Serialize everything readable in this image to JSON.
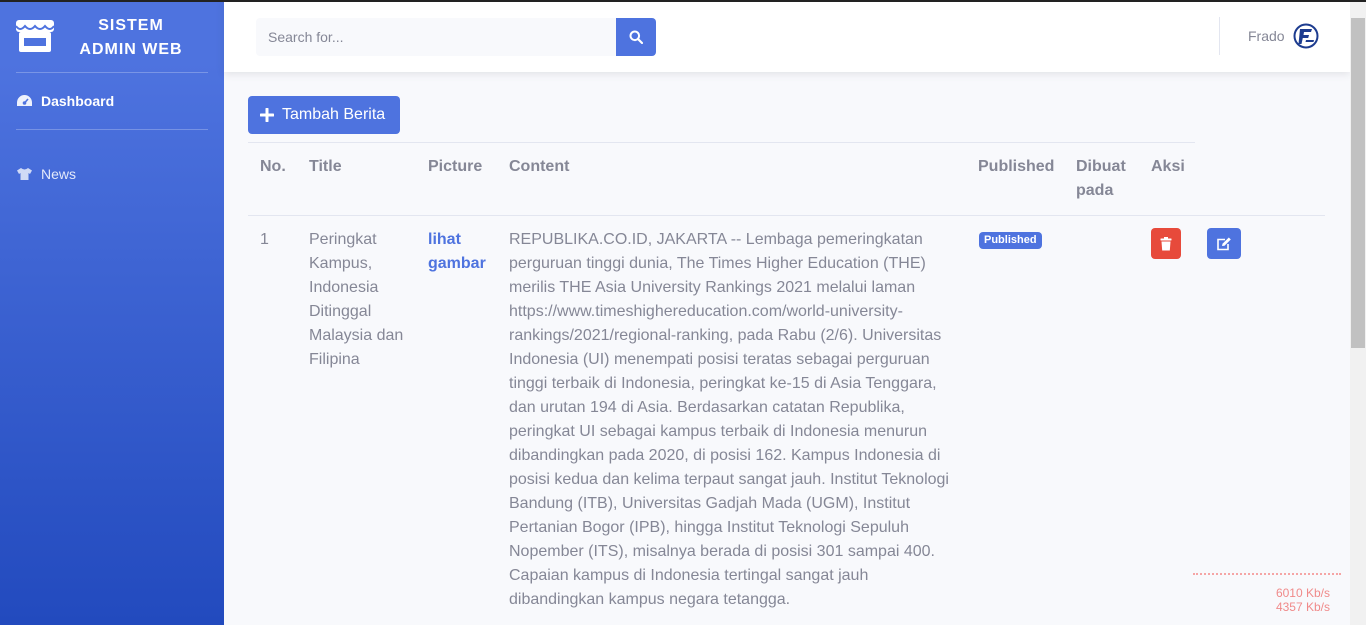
{
  "sidebar": {
    "brand_line1": "SISTEM",
    "brand_line2": "ADMIN WEB",
    "items": [
      {
        "label": "Dashboard",
        "icon": "tachometer-icon",
        "active": true
      },
      {
        "label": "News",
        "icon": "tshirt-icon",
        "active": false
      }
    ]
  },
  "topbar": {
    "search_placeholder": "Search for...",
    "user_name": "Frado"
  },
  "toolbar": {
    "add_label": "Tambah Berita"
  },
  "table": {
    "headers": [
      "No.",
      "Title",
      "Picture",
      "Content",
      "Published",
      "Dibuat pada",
      "Aksi"
    ],
    "rows": [
      {
        "no": "1",
        "title": "Peringkat Kampus, Indonesia Ditinggal Malaysia dan Filipina",
        "picture_link": "lihat gambar",
        "content": "REPUBLIKA.CO.ID, JAKARTA -- Lembaga pemeringkatan perguruan tinggi dunia, The Times Higher Education (THE) merilis THE Asia University Rankings 2021 melalui laman https://www.timeshighereducation.com/world-university-rankings/2021/regional-ranking, pada Rabu (2/6). Universitas Indonesia (UI) menempati posisi teratas sebagai perguruan tinggi terbaik di Indonesia, peringkat ke-15 di Asia Tenggara, dan urutan 194 di Asia. Berdasarkan catatan Republika, peringkat UI sebagai kampus terbaik di Indonesia menurun dibandingkan pada 2020, di posisi 162. Kampus Indonesia di posisi kedua dan kelima terpaut sangat jauh. Institut Teknologi Bandung (ITB), Universitas Gadjah Mada (UGM), Institut Pertanian Bogor (IPB), hingga Institut Teknologi Sepuluh Nopember (ITS), misalnya berada di posisi 301 sampai 400. Capaian kampus di Indonesia tertingal sangat jauh dibandingkan kampus negara tetangga.",
        "status": "Published",
        "created_at": ""
      }
    ]
  },
  "network": {
    "down": "6010 Kb/s",
    "up": "4357 Kb/s"
  },
  "colors": {
    "primary": "#4e73df",
    "danger": "#e74a3b",
    "text": "#858796"
  }
}
